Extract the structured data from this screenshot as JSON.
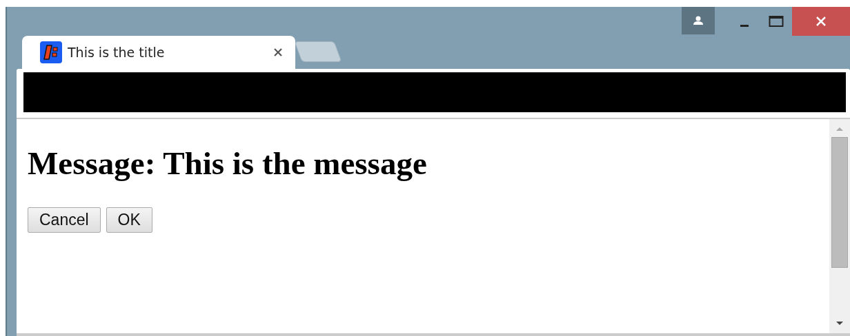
{
  "tabs": [
    {
      "title": "This is the title",
      "selected": true
    }
  ],
  "page": {
    "heading": "Message: This is the message",
    "buttons": [
      "Cancel",
      "OK"
    ]
  }
}
